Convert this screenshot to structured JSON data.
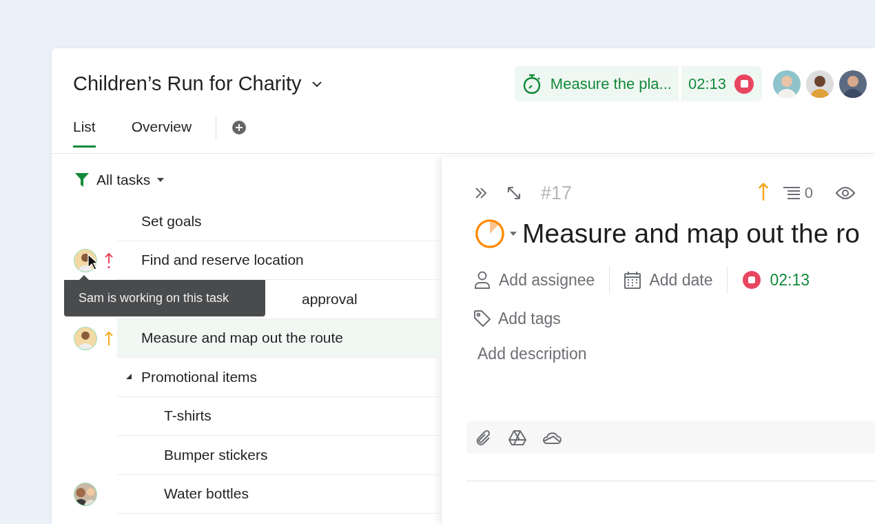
{
  "project": {
    "title": "Children’s Run for Charity"
  },
  "timer": {
    "task": "Measure the pla...",
    "time": "02:13",
    "running": true
  },
  "tabs": [
    {
      "label": "List",
      "selected": true
    },
    {
      "label": "Overview",
      "selected": false
    }
  ],
  "filter": {
    "label": "All tasks"
  },
  "tasks": [
    {
      "title": "Set goals",
      "assigned": false,
      "selected": false
    },
    {
      "title": "Find and reserve location",
      "assigned": true,
      "urgent": true,
      "color": "#e8455f",
      "selected": false
    },
    {
      "title": "approval",
      "assigned": false,
      "selected": false,
      "kind": "covered"
    },
    {
      "title": "Measure and map out the route",
      "assigned": true,
      "color": "#f6a821",
      "selected": true
    },
    {
      "title": "Promotional items",
      "assigned": false,
      "selected": false,
      "expanded": true,
      "children": [
        {
          "title": "T-shirts",
          "assigned": false,
          "selected": false
        },
        {
          "title": "Bumper stickers",
          "assigned": false,
          "selected": false
        },
        {
          "title": "Water bottles",
          "assigned": true,
          "shared": true,
          "selected": false
        }
      ]
    }
  ],
  "tooltip": {
    "text": "Sam is working on this task"
  },
  "detail": {
    "number": "#17",
    "color": "#f6a821",
    "comments": "0",
    "title": "Measure and map out the ro",
    "fields": [
      {
        "kind": "assignee",
        "label": "Add assignee"
      },
      {
        "kind": "date",
        "label": "Add date"
      },
      {
        "kind": "timer",
        "label": "02:13"
      }
    ],
    "tags": "Add tags",
    "description": {
      "placeholder": "Add description"
    }
  }
}
